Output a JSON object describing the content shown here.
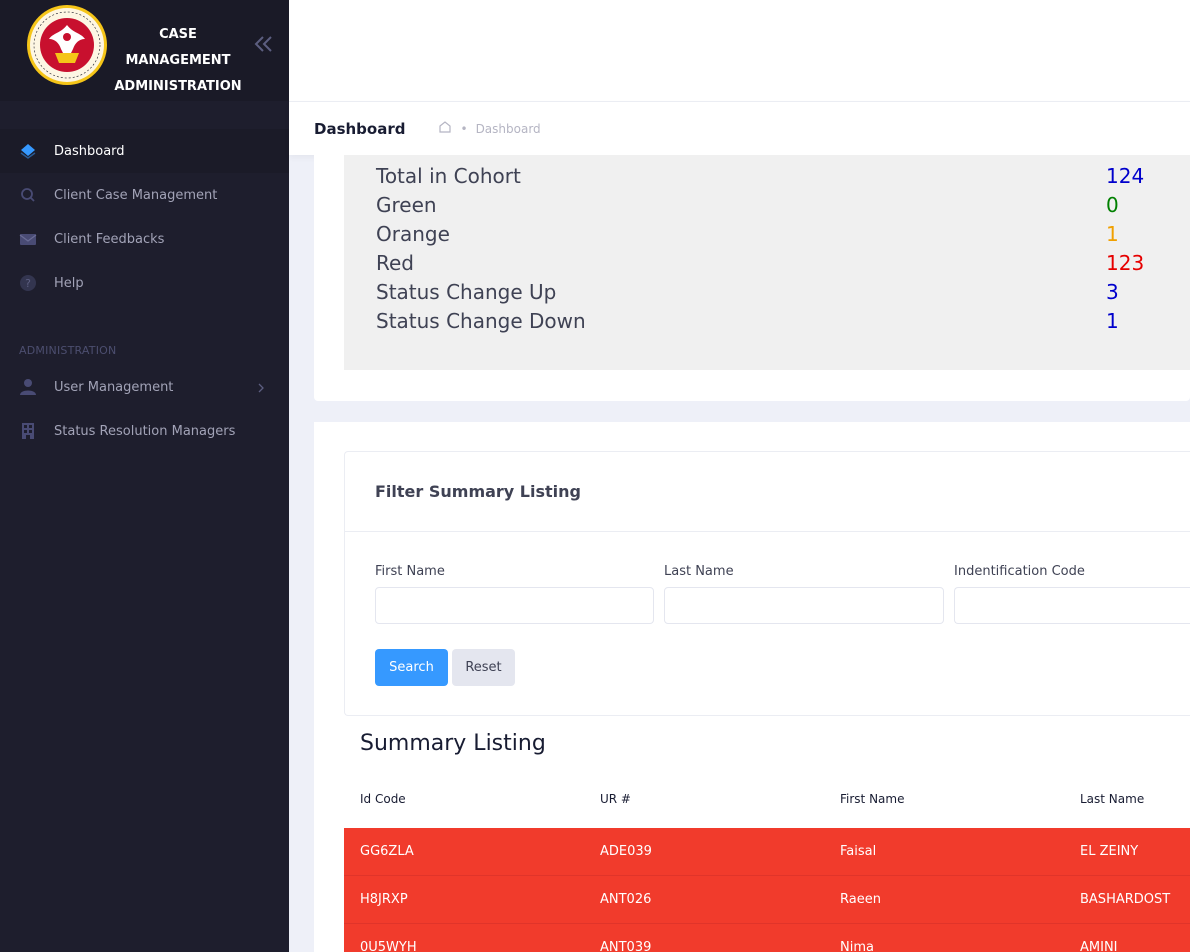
{
  "brand": {
    "line1": "CASE MANAGEMENT",
    "line2": "ADMINISTRATION",
    "logo_icon": "authority-emblem",
    "logo_text": "IMMIGRATION & CITIZENSHIP AUTHORITY"
  },
  "sidebar": {
    "items": [
      {
        "label": "Dashboard",
        "icon": "layers-icon",
        "active": true
      },
      {
        "label": "Client Case Management",
        "icon": "search-icon"
      },
      {
        "label": "Client Feedbacks",
        "icon": "mail-icon"
      },
      {
        "label": "Help",
        "icon": "help-icon"
      }
    ],
    "section": "ADMINISTRATION",
    "admin_items": [
      {
        "label": "User Management",
        "icon": "user-icon"
      },
      {
        "label": "Status Resolution Managers",
        "icon": "building-icon"
      }
    ]
  },
  "header": {
    "title": "Dashboard",
    "breadcrumb": "Dashboard"
  },
  "stats": [
    {
      "label": "Total in Cohort",
      "value": "124",
      "color": "#0000cc"
    },
    {
      "label": "Green",
      "value": "0",
      "color": "#008000"
    },
    {
      "label": "Orange",
      "value": "1",
      "color": "#f0a000"
    },
    {
      "label": "Red",
      "value": "123",
      "color": "#e60000"
    },
    {
      "label": "Status Change Up",
      "value": "3",
      "color": "#0000cc"
    },
    {
      "label": "Status Change Down",
      "value": "1",
      "color": "#0000cc"
    }
  ],
  "filter": {
    "title": "Filter Summary Listing",
    "first_name_label": "First Name",
    "last_name_label": "Last Name",
    "id_code_label": "Indentification Code",
    "first_name_value": "",
    "last_name_value": "",
    "id_code_value": "",
    "search_label": "Search",
    "reset_label": "Reset"
  },
  "listing": {
    "title": "Summary Listing",
    "columns": [
      "Id Code",
      "UR #",
      "First Name",
      "Last Name"
    ],
    "rows": [
      [
        "GG6ZLA",
        "ADE039",
        "Faisal",
        "EL ZEINY"
      ],
      [
        "H8JRXP",
        "ANT026",
        "Raeen",
        "BASHARDOST"
      ],
      [
        "0U5WYH",
        "ANT039",
        "Nima",
        "AMINI"
      ]
    ],
    "row_color": "#f13b2c"
  }
}
